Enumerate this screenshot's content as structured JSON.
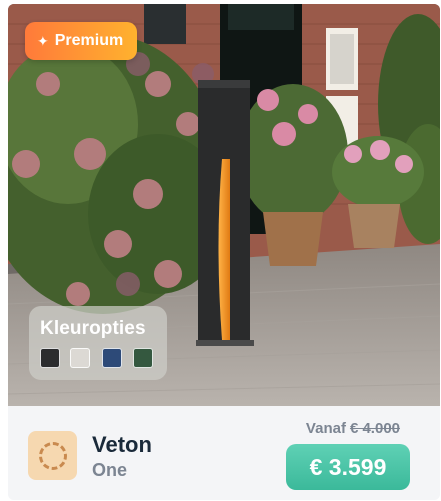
{
  "badge": {
    "label": "Premium",
    "icon": "sparkle-icon"
  },
  "colors": {
    "title": "Kleuropties",
    "swatches": [
      {
        "name": "anthracite",
        "hex": "#2b2c2e"
      },
      {
        "name": "light-grey",
        "hex": "#dcd9d4"
      },
      {
        "name": "blue",
        "hex": "#2d4a78"
      },
      {
        "name": "green",
        "hex": "#34583f"
      }
    ]
  },
  "product": {
    "name": "Veton",
    "subtitle": "One",
    "from_label": "Vanaf",
    "old_price": "€ 4.000",
    "price": "€ 3.599",
    "accent": "#3bb99a"
  }
}
